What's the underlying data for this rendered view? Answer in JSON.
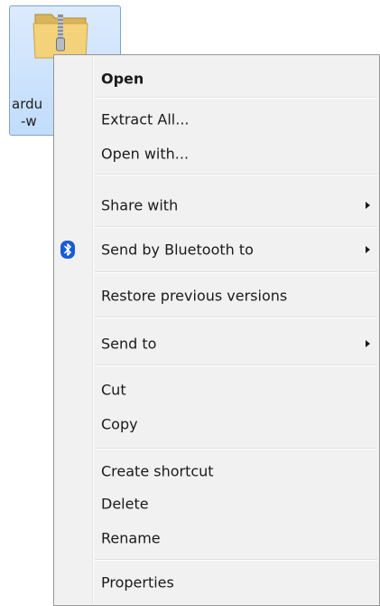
{
  "file": {
    "icon": "zip-folder-icon",
    "label_line1": "ardu",
    "label_line2": "-w"
  },
  "menu": {
    "items": [
      {
        "label": "Open",
        "bold": true
      },
      {
        "label": "Extract All..."
      },
      {
        "label": "Open with..."
      },
      {
        "label": "Share with",
        "submenu": true
      },
      {
        "label": "Send by Bluetooth to",
        "submenu": true,
        "icon": "bluetooth-icon"
      },
      {
        "label": "Restore previous versions"
      },
      {
        "label": "Send to",
        "submenu": true
      },
      {
        "label": "Cut"
      },
      {
        "label": "Copy"
      },
      {
        "label": "Create shortcut"
      },
      {
        "label": "Delete"
      },
      {
        "label": "Rename"
      },
      {
        "label": "Properties"
      }
    ]
  },
  "colors": {
    "selection_fill": "#c1dcfc",
    "selection_border": "#7da2ce",
    "menu_background": "#f1f1f1",
    "bluetooth_blue": "#1a5bd6"
  }
}
